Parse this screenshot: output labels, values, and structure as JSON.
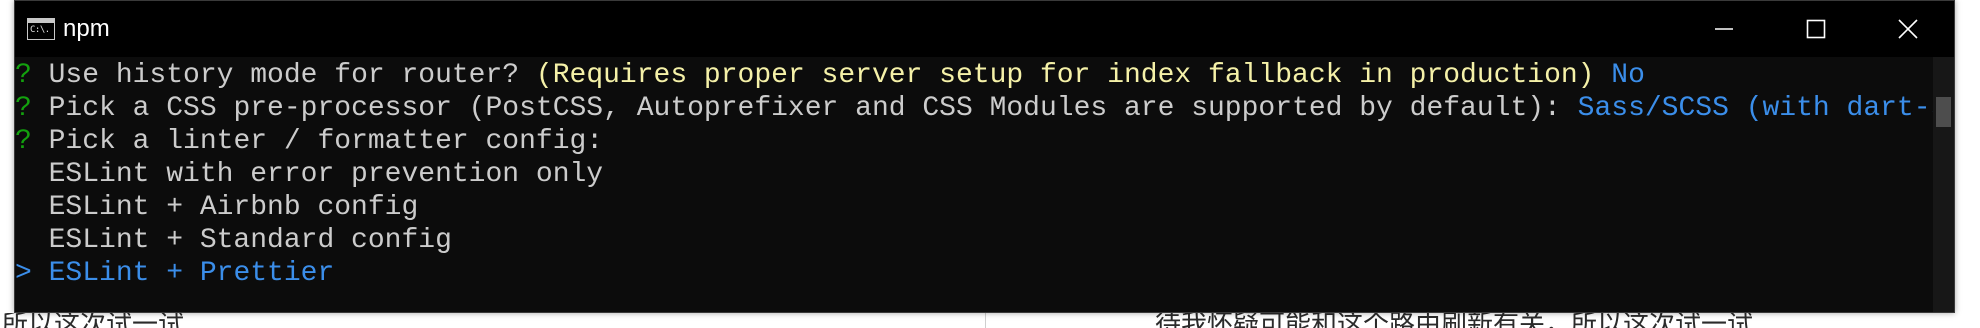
{
  "window": {
    "title": "npm",
    "icon_label": "C:\\."
  },
  "console": {
    "line1": {
      "prefix": "?",
      "question": " Use history mode for router? ",
      "hint": "(Requires proper server setup for index fallback in production)",
      "answer": " No"
    },
    "line2": {
      "prefix": "?",
      "question": " Pick a CSS pre-processor (PostCSS, Autoprefixer and CSS Modules are supported by default): ",
      "answer": "Sass/SCSS (with dart-sass)"
    },
    "line3": {
      "prefix": "?",
      "question": " Pick a linter / formatter config:"
    },
    "options": [
      "  ESLint with error prevention only",
      "  ESLint + Airbnb config",
      "  ESLint + Standard config"
    ],
    "selected": {
      "cursor": ">",
      "label": " ESLint + Prettier"
    }
  },
  "background": {
    "fragment_left": "所以这次试一试",
    "fragment_right": "待我怀疑可能和这个路由刷新有关，所以这次试一试"
  },
  "colors": {
    "console_bg": "#0c0c0c",
    "prompt_green": "#13a10e",
    "hint_yellow": "#f5f1a8",
    "answer_blue": "#3b8eea"
  }
}
